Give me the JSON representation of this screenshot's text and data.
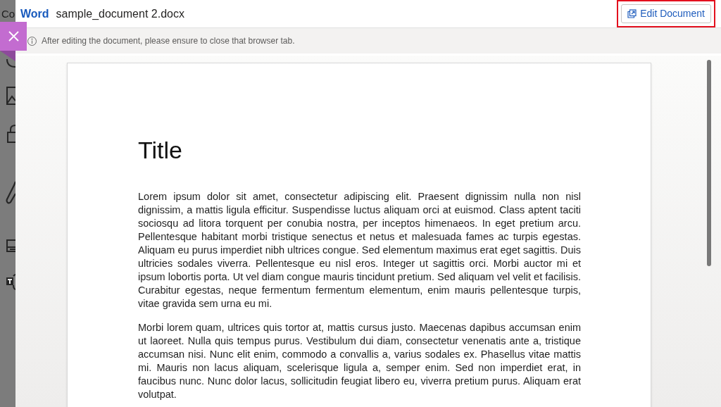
{
  "backdrop": {
    "label": "Co"
  },
  "header": {
    "app_name": "Word",
    "file_name": "sample_document 2.docx",
    "edit_button": {
      "label": "Edit Document",
      "highlighted": true
    }
  },
  "info_bar": {
    "message": "After editing the document, please ensure to close that browser tab."
  },
  "document": {
    "title": "Title",
    "paragraphs": [
      "Lorem ipsum dolor sit amet, consectetur adipiscing elit. Praesent dignissim nulla non nisl dignissim, a mattis ligula efficitur. Suspendisse luctus aliquam orci at euismod. Class aptent taciti sociosqu ad litora torquent per conubia nostra, per inceptos himenaeos. In eget pretium arcu. Pellentesque habitant morbi tristique senectus et netus et malesuada fames ac turpis egestas. Aliquam eu purus imperdiet nibh ultrices congue. Sed elementum maximus erat eget sagittis. Duis ultricies sodales viverra. Pellentesque eu nisl eros. Integer ut sagittis orci. Morbi auctor mi et ipsum lobortis porta. Ut vel diam congue mauris tincidunt pretium. Sed aliquam vel velit et facilisis. Curabitur egestas, neque fermentum fermentum elementum, enim mauris pellentesque turpis, vitae gravida sem urna eu mi.",
      "Morbi lorem quam, ultrices quis tortor at, mattis cursus justo. Maecenas dapibus accumsan enim ut laoreet. Nulla quis tempus purus. Vestibulum dui diam, consectetur venenatis ante a, tristique accumsan nisi. Nunc elit enim, commodo a convallis a, varius sodales ex. Phasellus vitae mattis mi. Mauris non lacus aliquam, scelerisque ligula a, semper enim. Sed non imperdiet erat, in faucibus nunc. Nunc dolor lacus, sollicitudin feugiat libero eu, viverra pretium purus. Aliquam erat volutpat."
    ]
  }
}
